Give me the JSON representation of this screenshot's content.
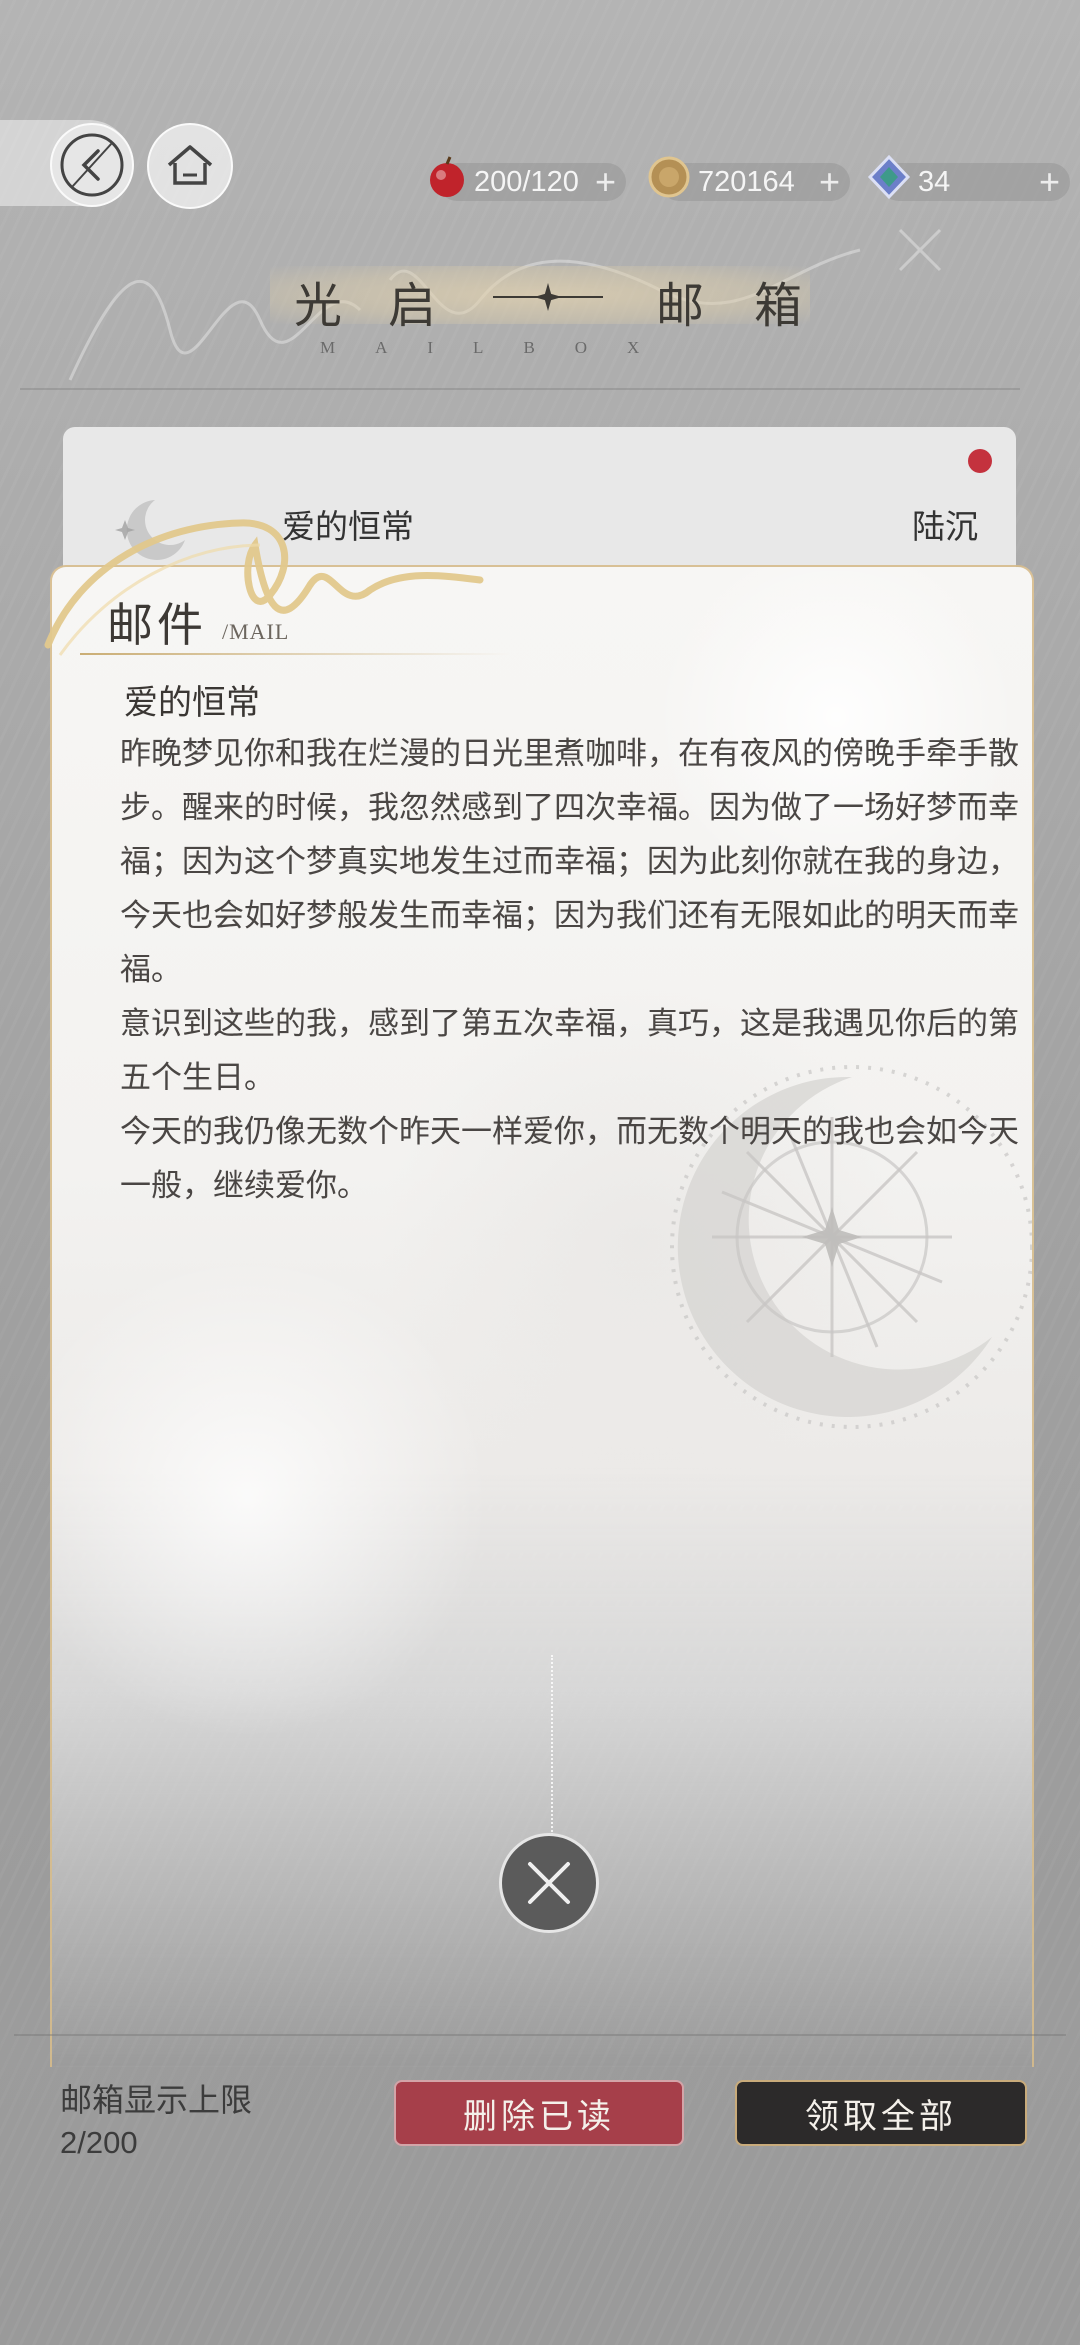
{
  "header": {
    "back_icon": "back-arrow-icon",
    "home_icon": "home-icon",
    "resources": [
      {
        "name": "stamina",
        "value": "200/120",
        "icon": "apple-icon",
        "color": "#c0232b"
      },
      {
        "name": "gold",
        "value": "720164",
        "icon": "coin-icon",
        "color": "#b49055"
      },
      {
        "name": "diamond",
        "value": "34",
        "icon": "diamond-icon",
        "color": "#6c7fc9"
      }
    ],
    "plus": "+"
  },
  "title": {
    "chars": [
      "光",
      "启",
      "邮",
      "箱"
    ],
    "subtitle": "MAILBOX"
  },
  "mail_list": {
    "items": [
      {
        "title": "爱的恒常",
        "sender": "陆沉",
        "unread": true
      }
    ]
  },
  "mail_detail": {
    "header": "邮件",
    "header_sub": "/MAIL",
    "subject": "爱的恒常",
    "paragraphs": [
      "昨晚梦见你和我在烂漫的日光里煮咖啡，在有夜风的傍晚手牵手散步。醒来的时候，我忽然感到了四次幸福。因为做了一场好梦而幸福；因为这个梦真实地发生过而幸福；因为此刻你就在我的身边，今天也会如好梦般发生而幸福；因为我们还有无限如此的明天而幸福。",
      "意识到这些的我，感到了第五次幸福，真巧，这是我遇见你后的第五个生日。",
      "今天的我仍像无数个昨天一样爱你，而无数个明天的我也会如今天一般，继续爱你。"
    ],
    "close_icon": "close-icon"
  },
  "footer": {
    "limit_label": "邮箱显示上限",
    "limit_count": "2/200",
    "delete_read": "删除已读",
    "claim_all": "领取全部"
  }
}
